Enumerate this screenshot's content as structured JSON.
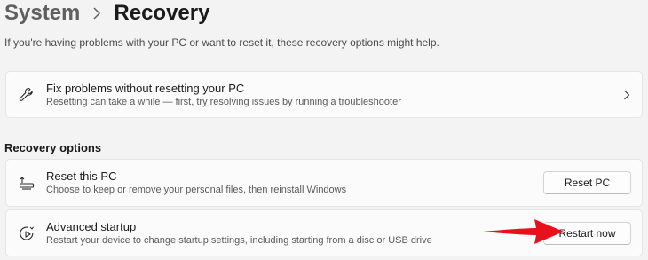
{
  "breadcrumb": {
    "parent": "System",
    "current": "Recovery"
  },
  "subtitle": "If you're having problems with your PC or want to reset it, these recovery options might help.",
  "troubleshoot_card": {
    "title": "Fix problems without resetting your PC",
    "description": "Resetting can take a while — first, try resolving issues by running a troubleshooter",
    "icon": "wrench-icon"
  },
  "recovery_options": {
    "heading": "Recovery options",
    "items": [
      {
        "title": "Reset this PC",
        "description": "Choose to keep or remove your personal files, then reinstall Windows",
        "button_label": "Reset PC",
        "icon": "reset-pc-icon"
      },
      {
        "title": "Advanced startup",
        "description": "Restart your device to change startup settings, including starting from a disc or USB drive",
        "button_label": "Restart now",
        "icon": "advanced-startup-icon"
      }
    ]
  },
  "colors": {
    "background": "#f3f3f3",
    "card": "#fbfbfb",
    "annotation_arrow": "#e8101a"
  }
}
